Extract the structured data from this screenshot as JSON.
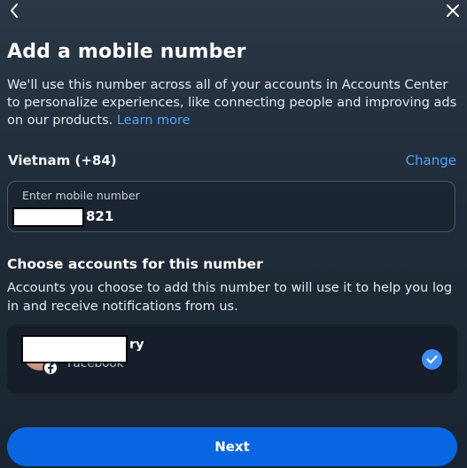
{
  "header": {
    "title": "Add a mobile number",
    "description": "We'll use this number across all of your accounts in Accounts Center to personalize experiences, like connecting people and improving ads on our products.",
    "learn_more": "Learn more"
  },
  "phone": {
    "country": "Vietnam (+84)",
    "change_label": "Change",
    "field_label": "Enter mobile number",
    "value_suffix": "821"
  },
  "accounts_section": {
    "title": "Choose accounts for this number",
    "description": "Accounts you choose to add this number to will use it to help you log in and receive notifications from us.",
    "accounts": [
      {
        "name_suffix": "ry",
        "platform": "Facebook",
        "selected": true
      }
    ]
  },
  "actions": {
    "next_label": "Next"
  },
  "colors": {
    "accent": "#4aa3ff",
    "primary_button": "#0866e0",
    "check": "#3e8ef7"
  },
  "icons": {
    "back": "chevron-left-icon",
    "close": "close-icon",
    "check": "checkmark-icon",
    "badge": "facebook-icon"
  }
}
